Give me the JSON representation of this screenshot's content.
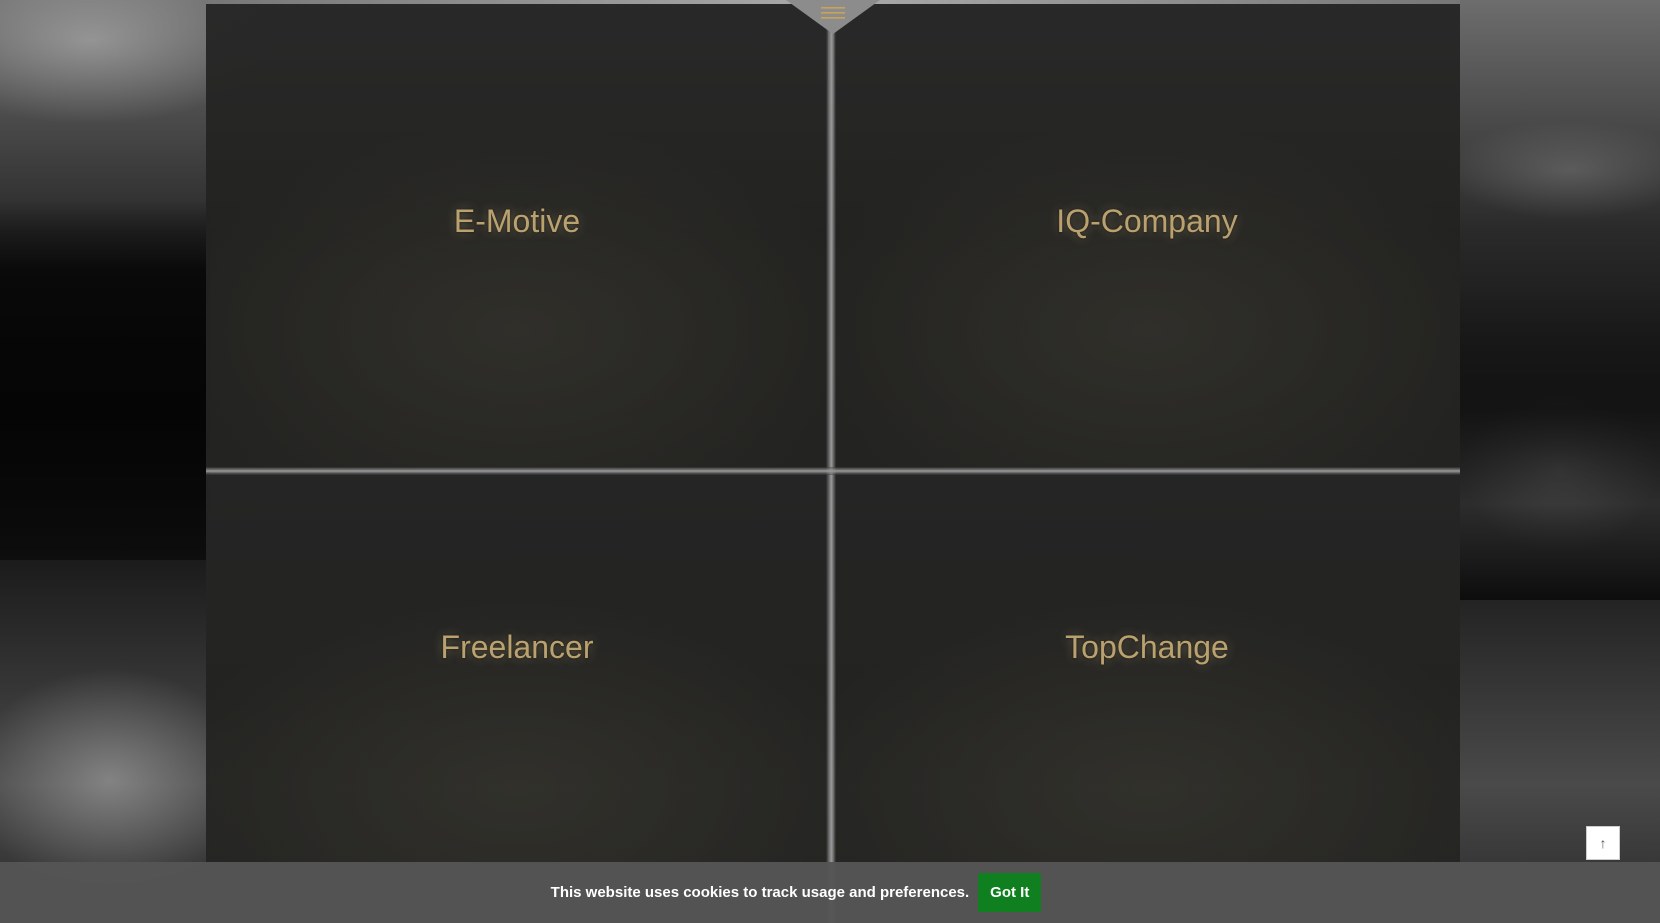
{
  "tiles": [
    {
      "label": "E-Motive"
    },
    {
      "label": "IQ-Company"
    },
    {
      "label": "Freelancer"
    },
    {
      "label": "TopChange"
    }
  ],
  "cookie": {
    "message": "This website uses cookies to track usage and preferences.",
    "button_label": "Got It"
  },
  "scroll_top": {
    "glyph": "↑"
  },
  "colors": {
    "tile_label": "#b9a170",
    "accept_button": "#0f7f1f",
    "cookie_bar": "#555555"
  },
  "icons": {
    "menu": "hamburger-menu-icon",
    "scroll_top": "arrow-up-icon"
  }
}
